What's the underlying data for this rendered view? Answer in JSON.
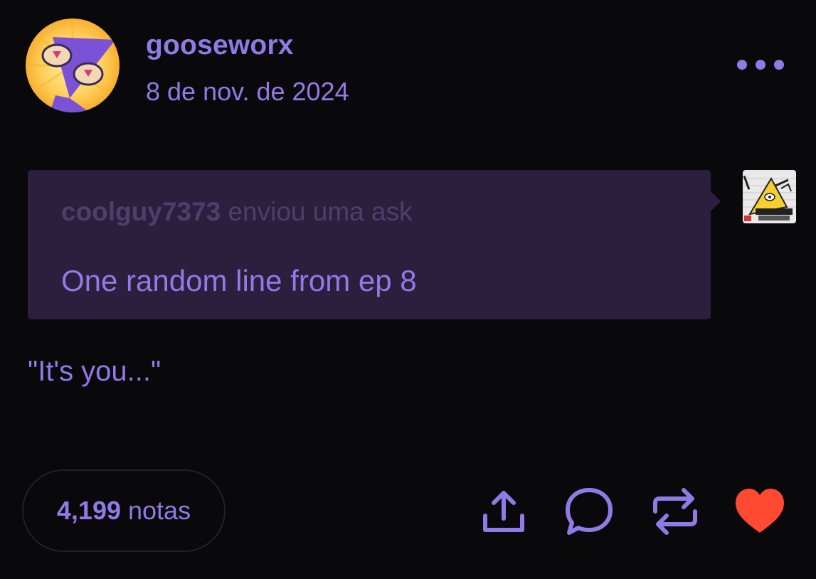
{
  "post": {
    "username": "gooseworx",
    "date": "8 de nov. de 2024",
    "ask": {
      "asker": "coolguy7373",
      "sent_label": "enviou uma ask",
      "question": "One random line from ep 8"
    },
    "answer": "\"It's you...\"",
    "footer": {
      "notes_count": "4,199",
      "notes_label": "notas"
    }
  },
  "icons": {
    "avatar": "triangle-character-avatar",
    "asker_avatar": "bill-cipher-card-avatar",
    "more": "more-options-icon",
    "share": "share-icon",
    "reply": "reply-icon",
    "reblog": "reblog-icon",
    "like": "heart-icon"
  },
  "colors": {
    "background": "#09090b",
    "accent": "#8f7ae6",
    "ask_background": "#2c1f3e",
    "ask_header_text": "#4e3e6b",
    "like": "#ff4930",
    "notes_border": "#222226"
  }
}
